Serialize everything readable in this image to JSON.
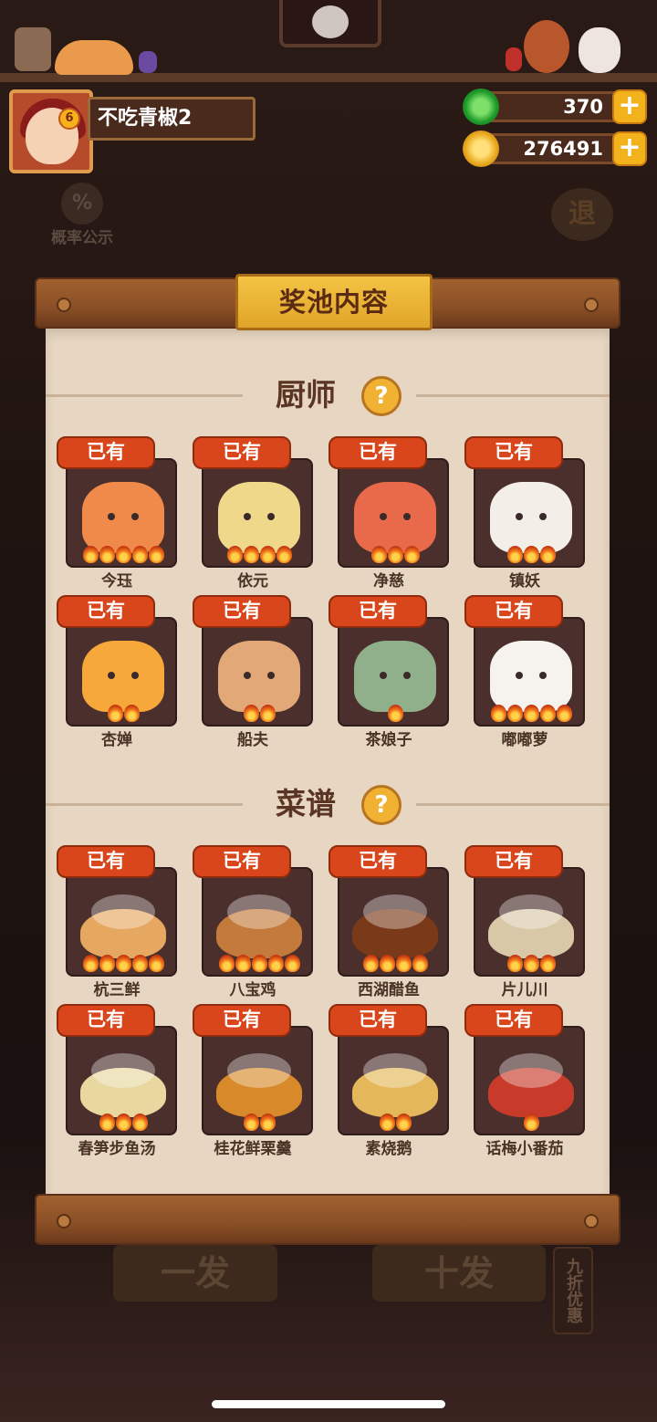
{
  "player": {
    "name": "不吃青椒2",
    "level": "6"
  },
  "currencies": [
    {
      "id": "jade",
      "value": "370",
      "icon": "jade-coin-icon"
    },
    {
      "id": "gold",
      "value": "276491",
      "icon": "copper-coin-icon"
    }
  ],
  "background": {
    "probability_label": "概率公示",
    "probability_icon": "%",
    "exit_label": "退",
    "single_draw_label": "一发",
    "ten_draw_label": "十发",
    "discount_label": "九折优惠"
  },
  "panel": {
    "title": "奖池内容",
    "owned_label": "已有",
    "help_symbol": "?"
  },
  "sections": [
    {
      "title": "厨师",
      "items": [
        {
          "name": "今珏",
          "stars": 5,
          "color": "#f08a4a"
        },
        {
          "name": "依元",
          "stars": 4,
          "color": "#efd88a"
        },
        {
          "name": "净慈",
          "stars": 3,
          "color": "#e86a4a"
        },
        {
          "name": "镇妖",
          "stars": 3,
          "color": "#f4eee8"
        },
        {
          "name": "杏婵",
          "stars": 2,
          "color": "#f7a83a"
        },
        {
          "name": "船夫",
          "stars": 2,
          "color": "#e3a878"
        },
        {
          "name": "茶娘子",
          "stars": 1,
          "color": "#8fb08a"
        },
        {
          "name": "嘟嘟萝",
          "stars": 5,
          "color": "#f6f2ee"
        }
      ]
    },
    {
      "title": "菜谱",
      "items": [
        {
          "name": "杭三鲜",
          "stars": 5,
          "color": "#e6a860"
        },
        {
          "name": "八宝鸡",
          "stars": 5,
          "color": "#c47a3a"
        },
        {
          "name": "西湖醋鱼",
          "stars": 4,
          "color": "#7a3a1a"
        },
        {
          "name": "片儿川",
          "stars": 3,
          "color": "#d8c8a8"
        },
        {
          "name": "春笋步鱼汤",
          "stars": 3,
          "color": "#e8d8a0"
        },
        {
          "name": "桂花鲜栗羹",
          "stars": 2,
          "color": "#d88a2a"
        },
        {
          "name": "素烧鹅",
          "stars": 2,
          "color": "#e4b85a"
        },
        {
          "name": "话梅小番茄",
          "stars": 1,
          "color": "#c83a2a"
        }
      ]
    }
  ]
}
